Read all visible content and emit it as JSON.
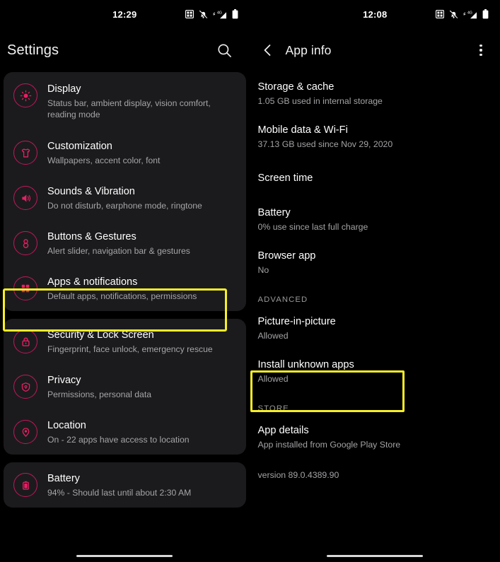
{
  "left_phone": {
    "status_bar": {
      "time": "12:29",
      "icons": [
        "app-badge-icon",
        "notifications-muted-icon",
        "signal-4g-icon",
        "battery-icon"
      ]
    },
    "header": {
      "title": "Settings",
      "search_icon": "search-icon"
    },
    "groups": [
      {
        "items": [
          {
            "icon": "brightness-icon",
            "title": "Display",
            "subtitle": "Status bar, ambient display, vision comfort, reading mode"
          },
          {
            "icon": "tshirt-icon",
            "title": "Customization",
            "subtitle": "Wallpapers, accent color, font"
          },
          {
            "icon": "speaker-icon",
            "title": "Sounds & Vibration",
            "subtitle": "Do not disturb, earphone mode, ringtone"
          },
          {
            "icon": "gesture-icon",
            "title": "Buttons & Gestures",
            "subtitle": "Alert slider, navigation bar & gestures"
          },
          {
            "icon": "apps-grid-icon",
            "title": "Apps & notifications",
            "subtitle": "Default apps, notifications, permissions"
          }
        ]
      },
      {
        "items": [
          {
            "icon": "lock-icon",
            "title": "Security & Lock Screen",
            "subtitle": "Fingerprint, face unlock, emergency rescue"
          },
          {
            "icon": "shield-icon",
            "title": "Privacy",
            "subtitle": "Permissions, personal data"
          },
          {
            "icon": "location-pin-icon",
            "title": "Location",
            "subtitle": "On - 22 apps have access to location"
          }
        ]
      },
      {
        "items": [
          {
            "icon": "battery-icon",
            "title": "Battery",
            "subtitle": "94% - Should last until about 2:30 AM"
          }
        ]
      }
    ],
    "highlight_target": "Apps & notifications"
  },
  "right_phone": {
    "status_bar": {
      "time": "12:08",
      "icons": [
        "app-badge-icon",
        "notifications-muted-icon",
        "signal-4g-icon",
        "battery-icon"
      ]
    },
    "header": {
      "back_icon": "back-chevron-icon",
      "title": "App info",
      "menu_icon": "overflow-menu-icon"
    },
    "rows": [
      {
        "title": "Storage & cache",
        "subtitle": "1.05 GB used in internal storage"
      },
      {
        "title": "Mobile data & Wi-Fi",
        "subtitle": "37.13 GB used since Nov 29, 2020"
      },
      {
        "title": "Screen time",
        "subtitle": ""
      },
      {
        "title": "Battery",
        "subtitle": "0% use since last full charge"
      },
      {
        "title": "Browser app",
        "subtitle": "No"
      }
    ],
    "advanced_section_label": "ADVANCED",
    "advanced_rows": [
      {
        "title": "Picture-in-picture",
        "subtitle": "Allowed"
      },
      {
        "title": "Install unknown apps",
        "subtitle": "Allowed"
      }
    ],
    "store_section_label": "STORE",
    "store_rows": [
      {
        "title": "App details",
        "subtitle": "App installed from Google Play Store"
      }
    ],
    "version_text": "version 89.0.4389.90",
    "highlight_target": "Install unknown apps"
  },
  "colors": {
    "accent_pink": "#c2185b",
    "highlight_yellow": "#f6ef26",
    "card_bg": "#1b1b1d",
    "page_bg": "#000000"
  }
}
